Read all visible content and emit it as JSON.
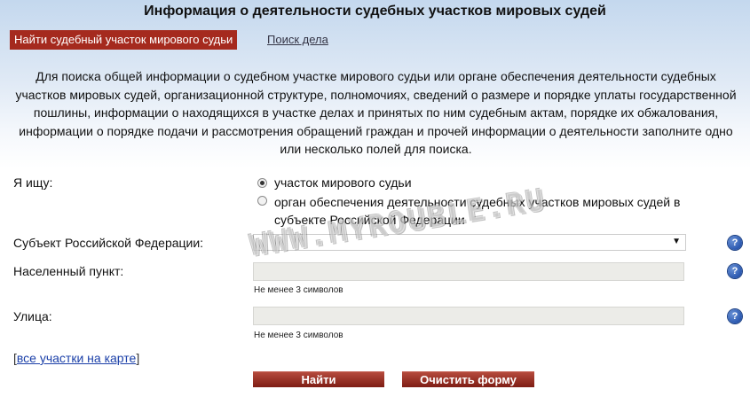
{
  "page": {
    "title": "Информация о деятельности судебных участков мировых судей"
  },
  "tabs": {
    "active": "Найти судебный участок мирового судьи",
    "case_search": "Поиск дела"
  },
  "intro": "Для поиска общей информации о судебном участке мирового судьи или органе обеспечения деятельности судебных участков мировых судей, организационной структуре, полномочиях, сведений о размере и порядке уплаты государственной пошлины, информации о находящихся в участке делах и принятых по ним судебным актам, порядке их обжалования, информации о порядке подачи и рассмотрения обращений граждан и прочей информации о деятельности заполните одно или несколько полей для поиска.",
  "form": {
    "search_for_label": "Я ищу:",
    "option_1": "участок мирового судьи",
    "option_2": "орган обеспечения деятельности судебных участков мировых судей в субъекте Российской Федерации",
    "selected_option": 1,
    "region_label": "Субъект Российской Федерации:",
    "region_value": "",
    "locality_label": "Населенный пункт:",
    "locality_value": "",
    "locality_hint": "Не менее 3 символов",
    "street_label": "Улица:",
    "street_value": "",
    "street_hint": "Не менее 3 символов"
  },
  "links": {
    "map_open": "[",
    "map_text": "все участки на карте",
    "map_close": "]"
  },
  "buttons": {
    "find": "Найти",
    "clear": "Очистить форму"
  },
  "help_glyph": "?",
  "watermark": "WWW.MYROUBLE.RU",
  "colors": {
    "accent_red": "#a52a1e",
    "help_blue": "#2a58b0"
  }
}
